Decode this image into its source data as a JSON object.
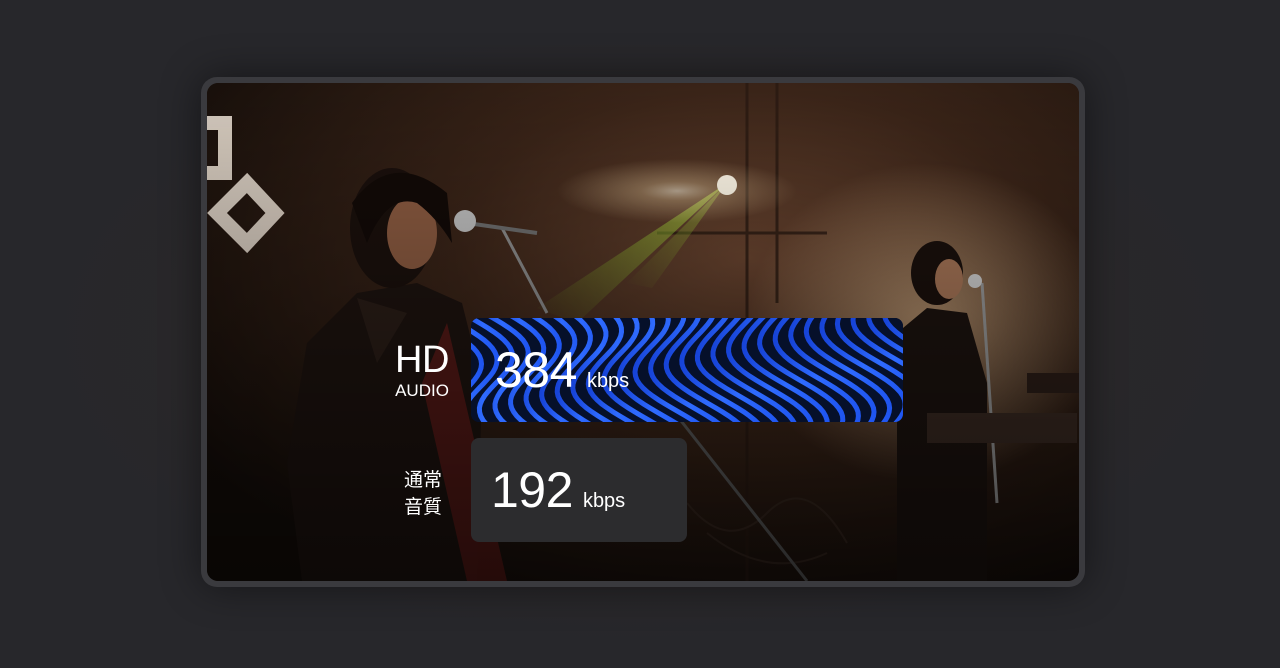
{
  "hd_audio": {
    "title": "HD",
    "subtitle": "AUDIO",
    "bitrate": "384",
    "unit": "kbps",
    "accent_color": "#1f5fff"
  },
  "normal_quality": {
    "label_line1": "通常",
    "label_line2": "音質",
    "bitrate": "192",
    "unit": "kbps",
    "card_color": "#2c2c2e"
  }
}
